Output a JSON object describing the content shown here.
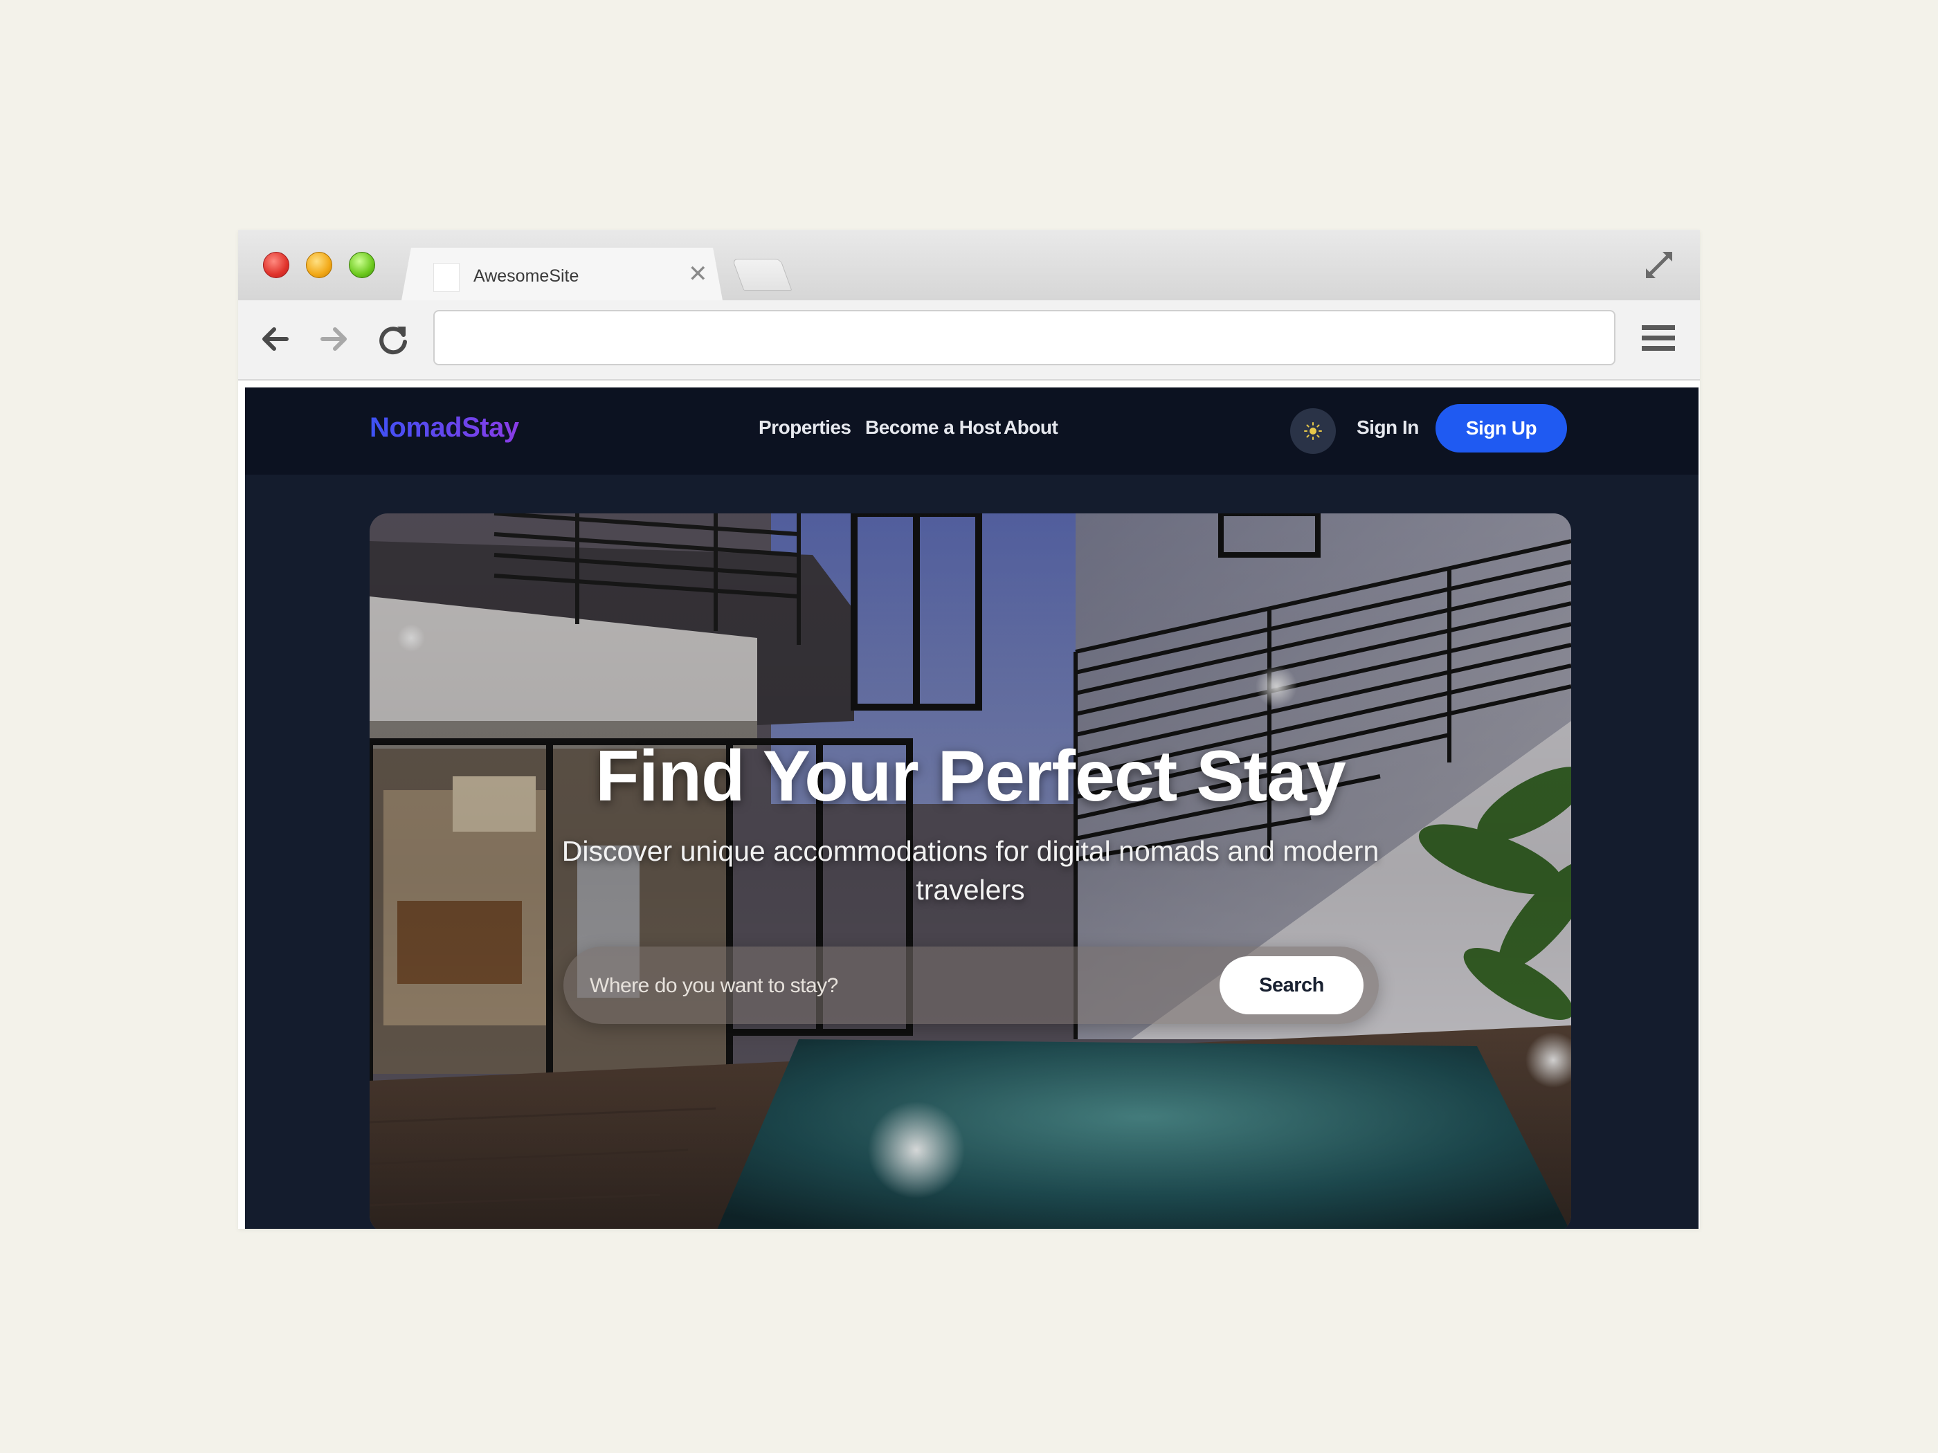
{
  "browser": {
    "tab_title": "AwesomeSite",
    "tab_close": "✕",
    "url": ""
  },
  "site": {
    "logo": "NomadStay",
    "nav": {
      "properties": "Properties",
      "host": "Become a Host",
      "about": "About"
    },
    "sign_in": "Sign In",
    "sign_up": "Sign Up"
  },
  "hero": {
    "title": "Find Your Perfect Stay",
    "subtitle": "Discover unique accommodations for digital nomads and modern travelers",
    "search_placeholder": "Where do you want to stay?",
    "search_button": "Search"
  },
  "colors": {
    "page_background": "#f3f2ea",
    "site_background": "#141c2d",
    "header_background": "#0c1221",
    "accent": "#1f5af2",
    "logo_gradient_start": "#3d52f5",
    "logo_gradient_end": "#8a3ce6"
  },
  "icons": {
    "close": "close-icon",
    "fullscreen": "fullscreen-icon",
    "back": "back-arrow-icon",
    "forward": "forward-arrow-icon",
    "reload": "reload-icon",
    "menu": "hamburger-menu-icon",
    "theme": "sun-icon"
  }
}
